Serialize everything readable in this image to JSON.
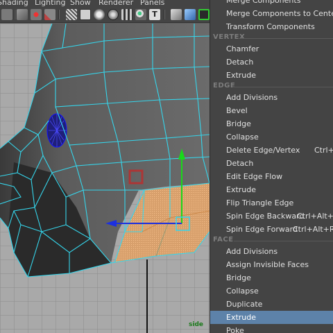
{
  "menubar": {
    "items": [
      "Shading",
      "Lighting",
      "Show",
      "Renderer",
      "Panels"
    ]
  },
  "toolbar": {
    "icons": [
      "select-mode-icon",
      "lasso-icon",
      "paint-icon",
      "camera-icon",
      "grid-icon",
      "wireframe-icon",
      "smooth-shade-icon",
      "texture-icon",
      "light-icon",
      "xray-icon",
      "text-icon",
      "isolate-icon",
      "cube-icon",
      "resolution-gate-icon"
    ]
  },
  "viewport": {
    "label": "side"
  },
  "context_menu": {
    "top_items": [
      "Merge Components",
      "Merge Components to Center",
      "Transform Components"
    ],
    "vertex_header": "VERTEX",
    "vertex_items": [
      "Chamfer",
      "Detach",
      "Extrude"
    ],
    "edge_header": "EDGE",
    "edge_items": [
      "Add Divisions",
      "Bevel",
      "Bridge",
      "Collapse",
      "Delete Edge/Vertex",
      "Detach",
      "Edit Edge Flow",
      "Extrude",
      "Flip Triangle Edge",
      "Spin Edge Backward",
      "Spin Edge Forward"
    ],
    "edge_shortcuts": {
      "delete_edge_vertex": "Ctrl+D",
      "spin_edge_backward": "Ctrl+Alt+Le",
      "spin_edge_forward": "Ctrl+Alt+Rig"
    },
    "face_header": "FACE",
    "face_items": [
      "Add Divisions",
      "Assign Invisible Faces",
      "Bridge",
      "Collapse",
      "Duplicate",
      "Extrude",
      "Poke"
    ],
    "highlighted": "Extrude"
  },
  "colors": {
    "menu_bg": "#444444",
    "highlight": "#5d82a9",
    "wire": "#35d6ec",
    "selected_face": "#f0a36a",
    "viewport_bg": "#a9a9a9",
    "manip_y": "#19d919",
    "manip_x": "#1c2fe0"
  }
}
